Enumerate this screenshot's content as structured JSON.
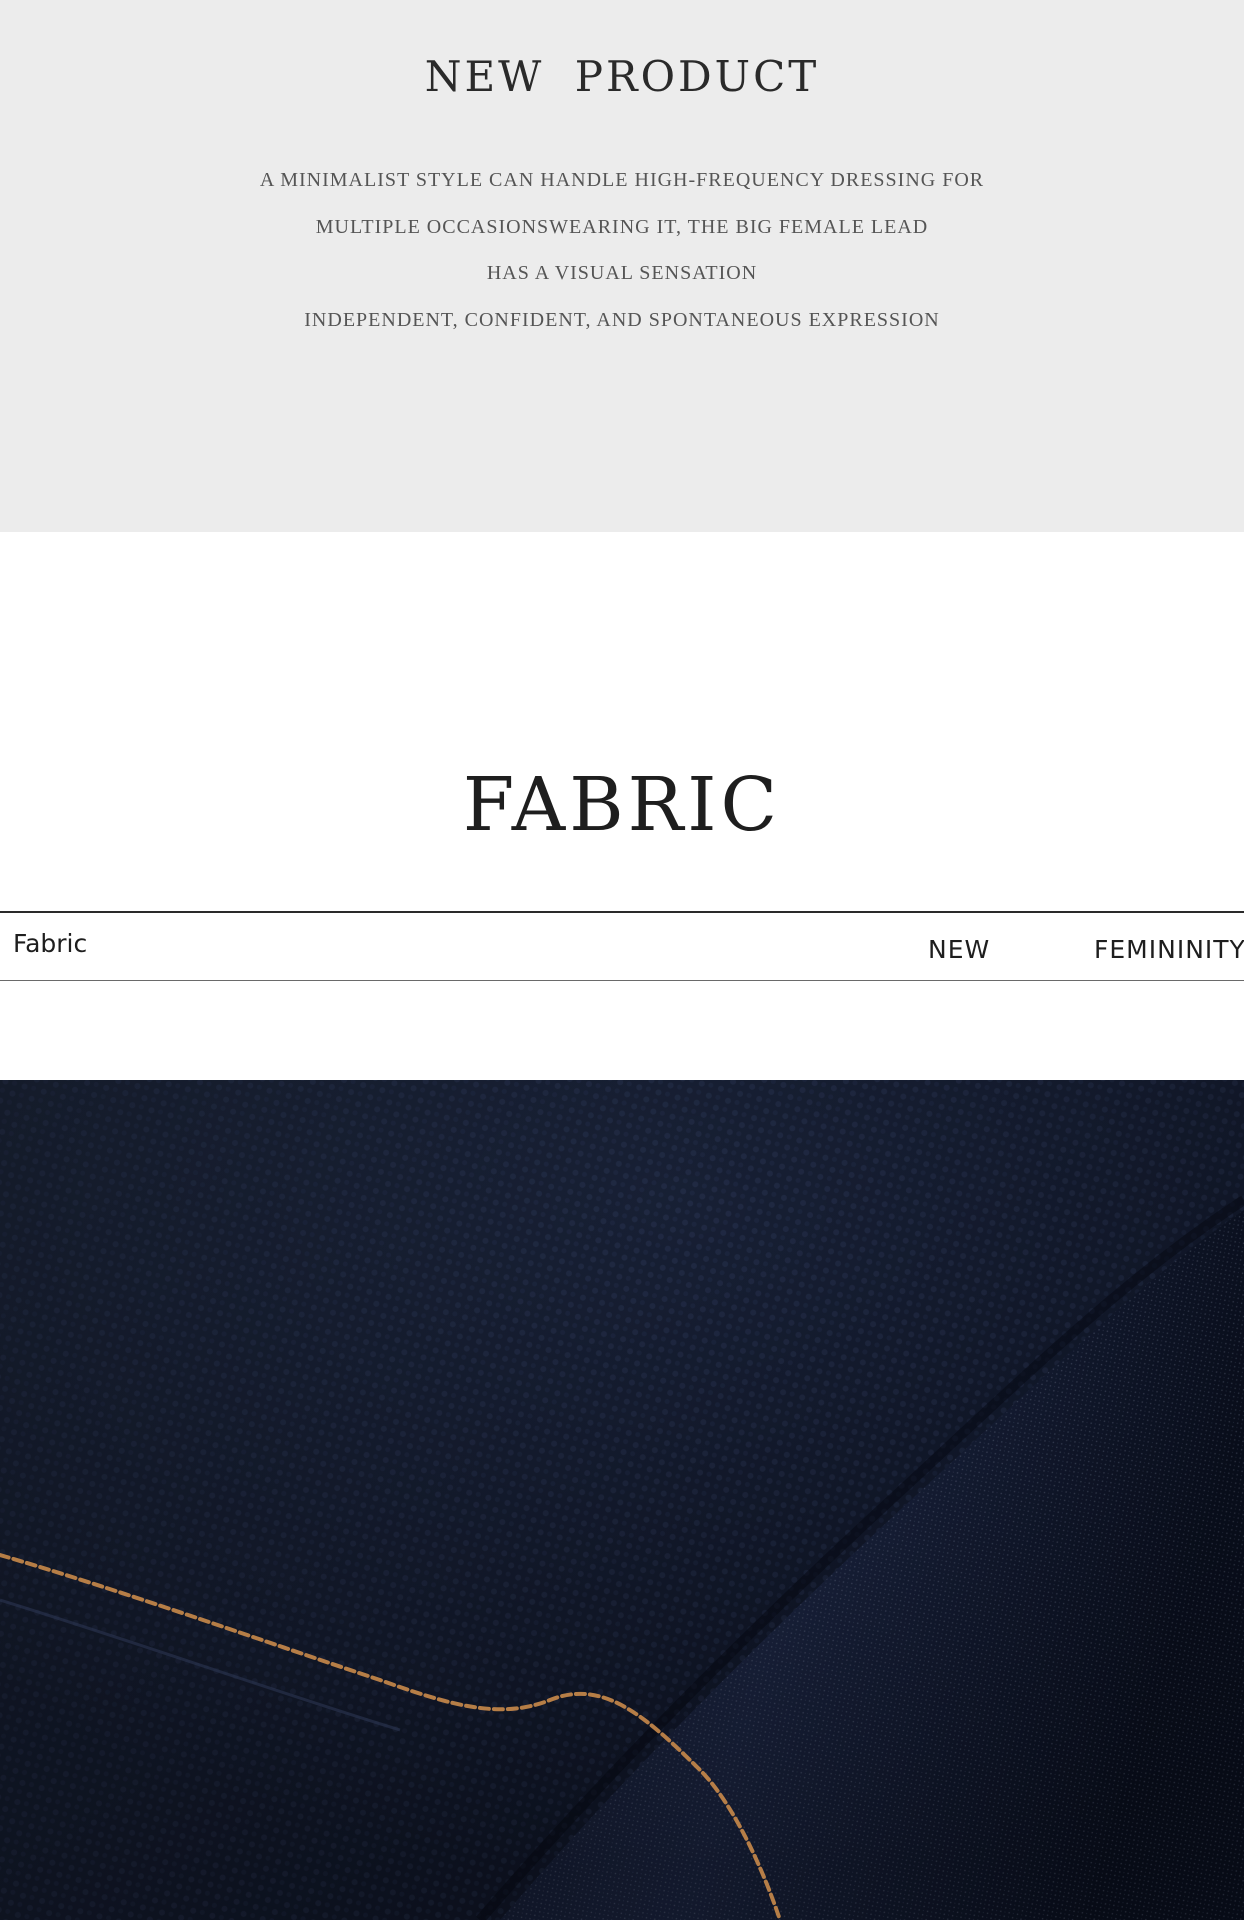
{
  "intro": {
    "title": "NEW PRODUCT",
    "lines": [
      "A MINIMALIST STYLE CAN HANDLE HIGH-FREQUENCY DRESSING FOR",
      "MULTIPLE OCCASIONSWEARING IT, THE BIG FEMALE LEAD",
      "HAS A VISUAL SENSATION",
      "INDEPENDENT, CONFIDENT, AND SPONTANEOUS EXPRESSION"
    ]
  },
  "fabric": {
    "title": "FABRIC",
    "bar": {
      "left_label": "Fabric",
      "tag_new": "NEW",
      "tag_femininity": "FEMININITY"
    }
  },
  "photo": {
    "subject": "dark indigo denim fabric close-up with tan stitching",
    "colors": {
      "denim_dark": "#0f1629",
      "denim_mid": "#1f2a45",
      "stitch": "#c98a4a"
    }
  }
}
